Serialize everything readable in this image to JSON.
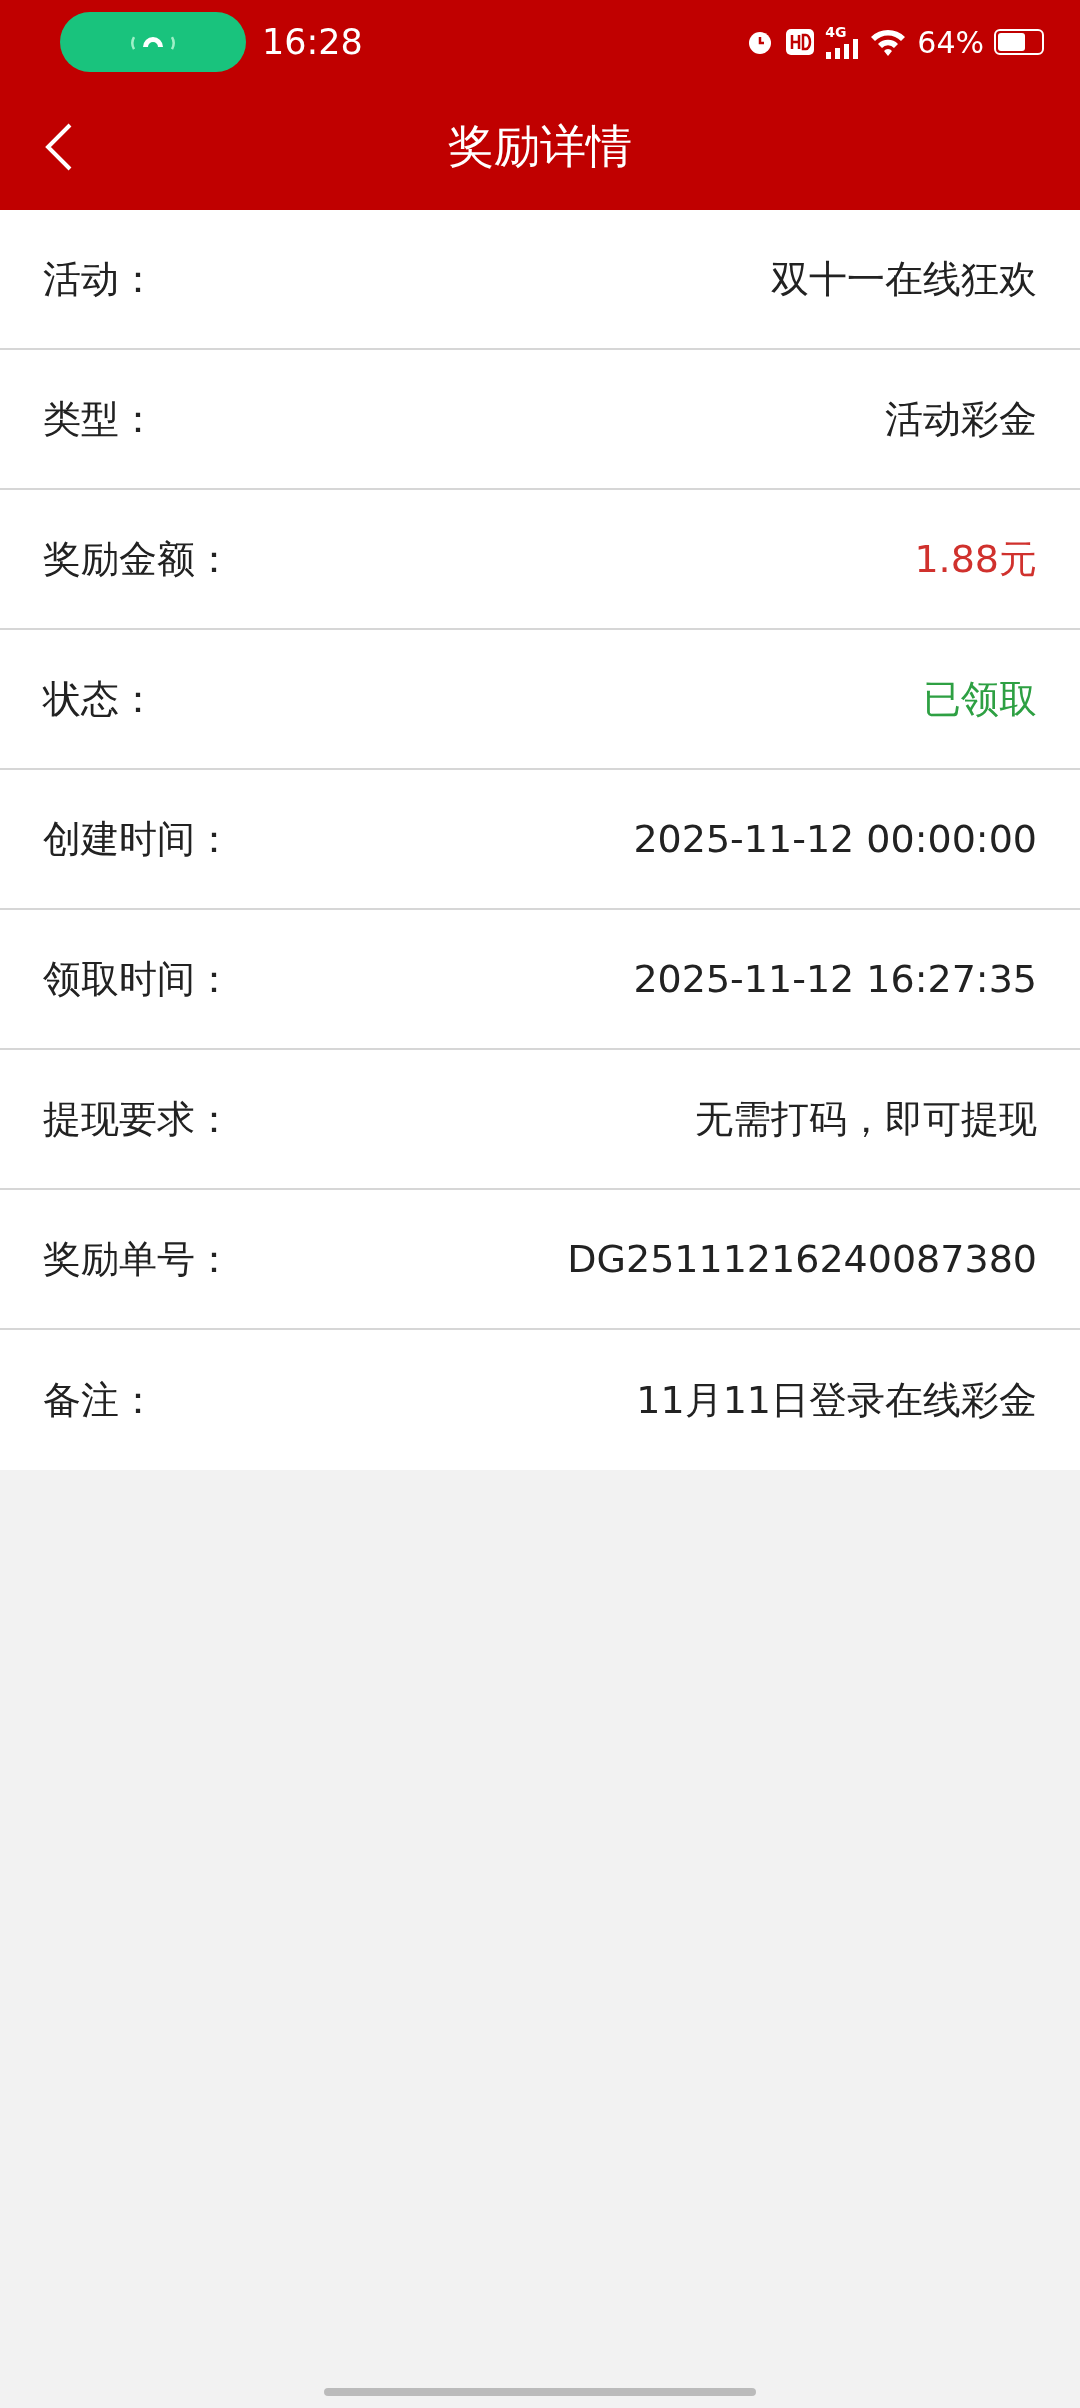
{
  "status_bar": {
    "time": "16:28",
    "network": "4G",
    "battery": "64%"
  },
  "header": {
    "title": "奖励详情"
  },
  "rows": [
    {
      "label": "活动：",
      "value": "双十一在线狂欢",
      "kind": "plain"
    },
    {
      "label": "类型：",
      "value": "活动彩金",
      "kind": "plain"
    },
    {
      "label": "奖励金额：",
      "value": "1.88元",
      "kind": "amount"
    },
    {
      "label": "状态：",
      "value": "已领取",
      "kind": "claimed"
    },
    {
      "label": "创建时间：",
      "value": "2025-11-12 00:00:00",
      "kind": "plain"
    },
    {
      "label": "领取时间：",
      "value": "2025-11-12 16:27:35",
      "kind": "plain"
    },
    {
      "label": "提现要求：",
      "value": "无需打码，即可提现",
      "kind": "plain"
    },
    {
      "label": "奖励单号：",
      "value": "DG25111216240087380",
      "kind": "plain"
    },
    {
      "label": "备注：",
      "value": "11月11日登录在线彩金",
      "kind": "plain"
    }
  ]
}
